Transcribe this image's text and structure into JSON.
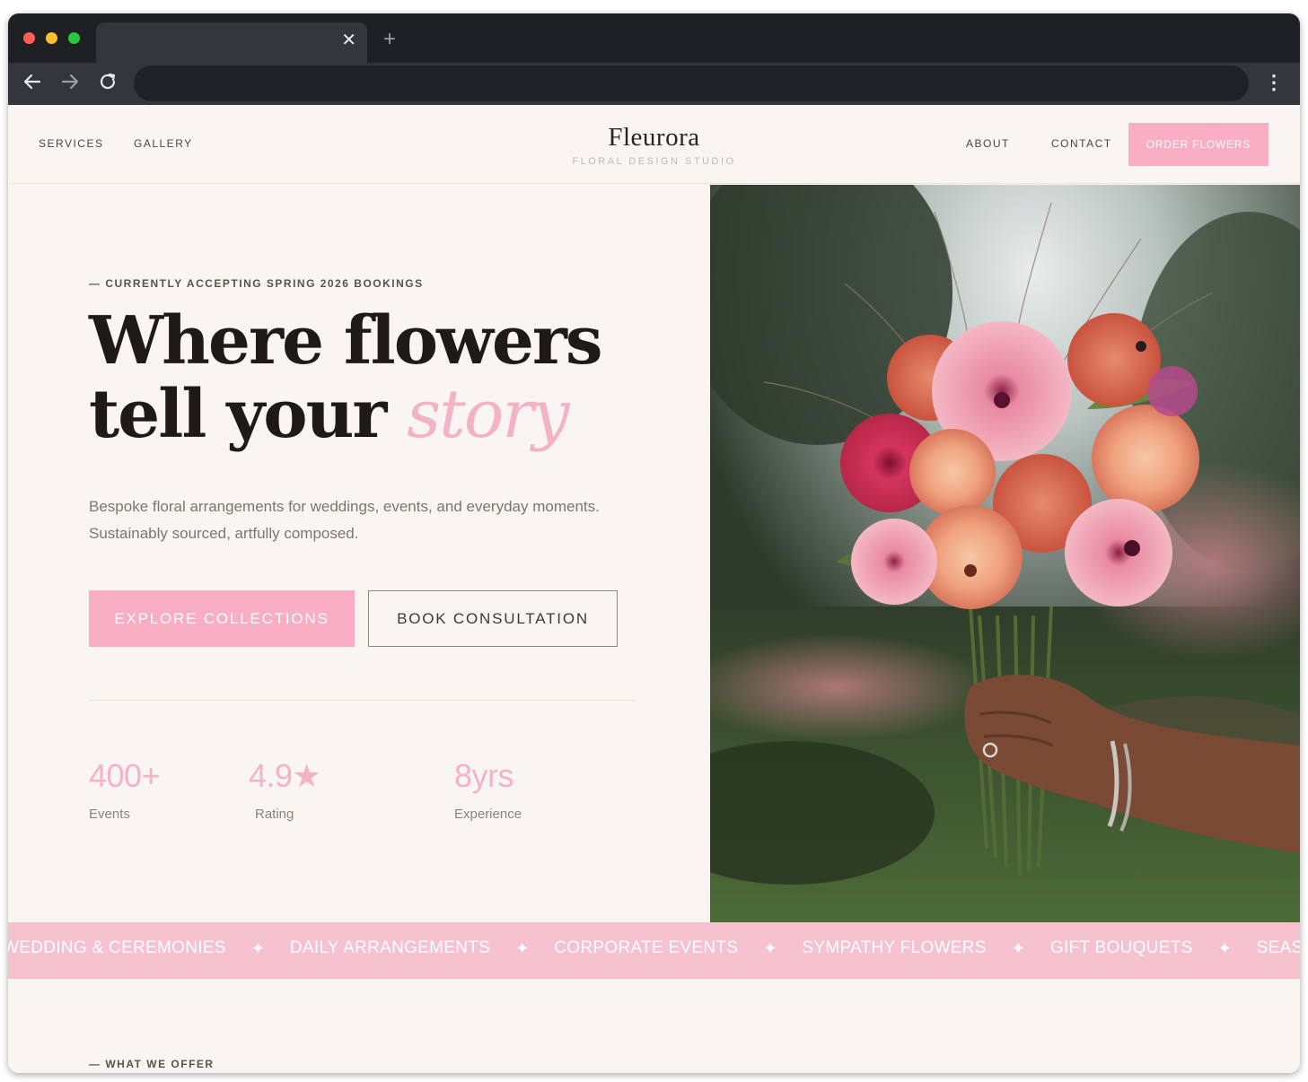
{
  "browser": {
    "tab_close": "✕",
    "new_tab": "+",
    "back": "←",
    "forward": "→",
    "reload": "⟳",
    "menu": "⋮"
  },
  "header": {
    "nav_left": [
      "SERVICES",
      "GALLERY"
    ],
    "logo": "Fleurora",
    "logo_sub": "FLORAL DESIGN STUDIO",
    "nav_right": [
      "ABOUT",
      "CONTACT"
    ],
    "cta": "ORDER FLOWERS"
  },
  "hero": {
    "eyebrow": "— CURRENTLY ACCEPTING SPRING 2026 BOOKINGS",
    "headline_line1": "Where flowers",
    "headline_line2": "tell your ",
    "headline_accent": "story",
    "lede": "Bespoke floral arrangements for weddings, events, and everyday moments. Sustainably sourced, artfully composed.",
    "primary_button": "EXPLORE COLLECTIONS",
    "secondary_button": "BOOK CONSULTATION",
    "stats": [
      {
        "value": "400+",
        "label": "Events"
      },
      {
        "value": "4.9★",
        "label": "Rating"
      },
      {
        "value": "8yrs",
        "label": "Experience"
      }
    ]
  },
  "band": {
    "items": [
      "WEDDING & CEREMONIES",
      "DAILY ARRANGEMENTS",
      "CORPORATE EVENTS",
      "SYMPATHY FLOWERS",
      "GIFT BOUQUETS",
      "SEASON"
    ],
    "separator": "✦"
  },
  "offer": {
    "eyebrow": "— WHAT WE OFFER"
  },
  "colors": {
    "accent_pink": "#f9aec1",
    "band_pink": "#f6c2cf",
    "background": "#f9f6f2",
    "text_dark": "#1e1a17"
  }
}
